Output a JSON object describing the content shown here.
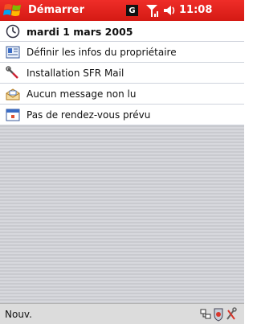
{
  "titlebar": {
    "title": "Démarrer",
    "status_letter": "G",
    "clock": "11:08"
  },
  "today": {
    "items": [
      {
        "label": "mardi 1 mars 2005",
        "icon": "clock-icon"
      },
      {
        "label": "Définir les infos du propriétaire",
        "icon": "owner-card-icon"
      },
      {
        "label": "Installation SFR Mail",
        "icon": "setup-tools-icon"
      },
      {
        "label": "Aucun message non lu",
        "icon": "mail-envelope-icon"
      },
      {
        "label": "Pas de rendez-vous prévu",
        "icon": "calendar-icon"
      }
    ]
  },
  "menubar": {
    "left_softkey": "Nouv."
  },
  "colors": {
    "titlebar": "#e3231d",
    "menubar": "#dcdcdc"
  }
}
